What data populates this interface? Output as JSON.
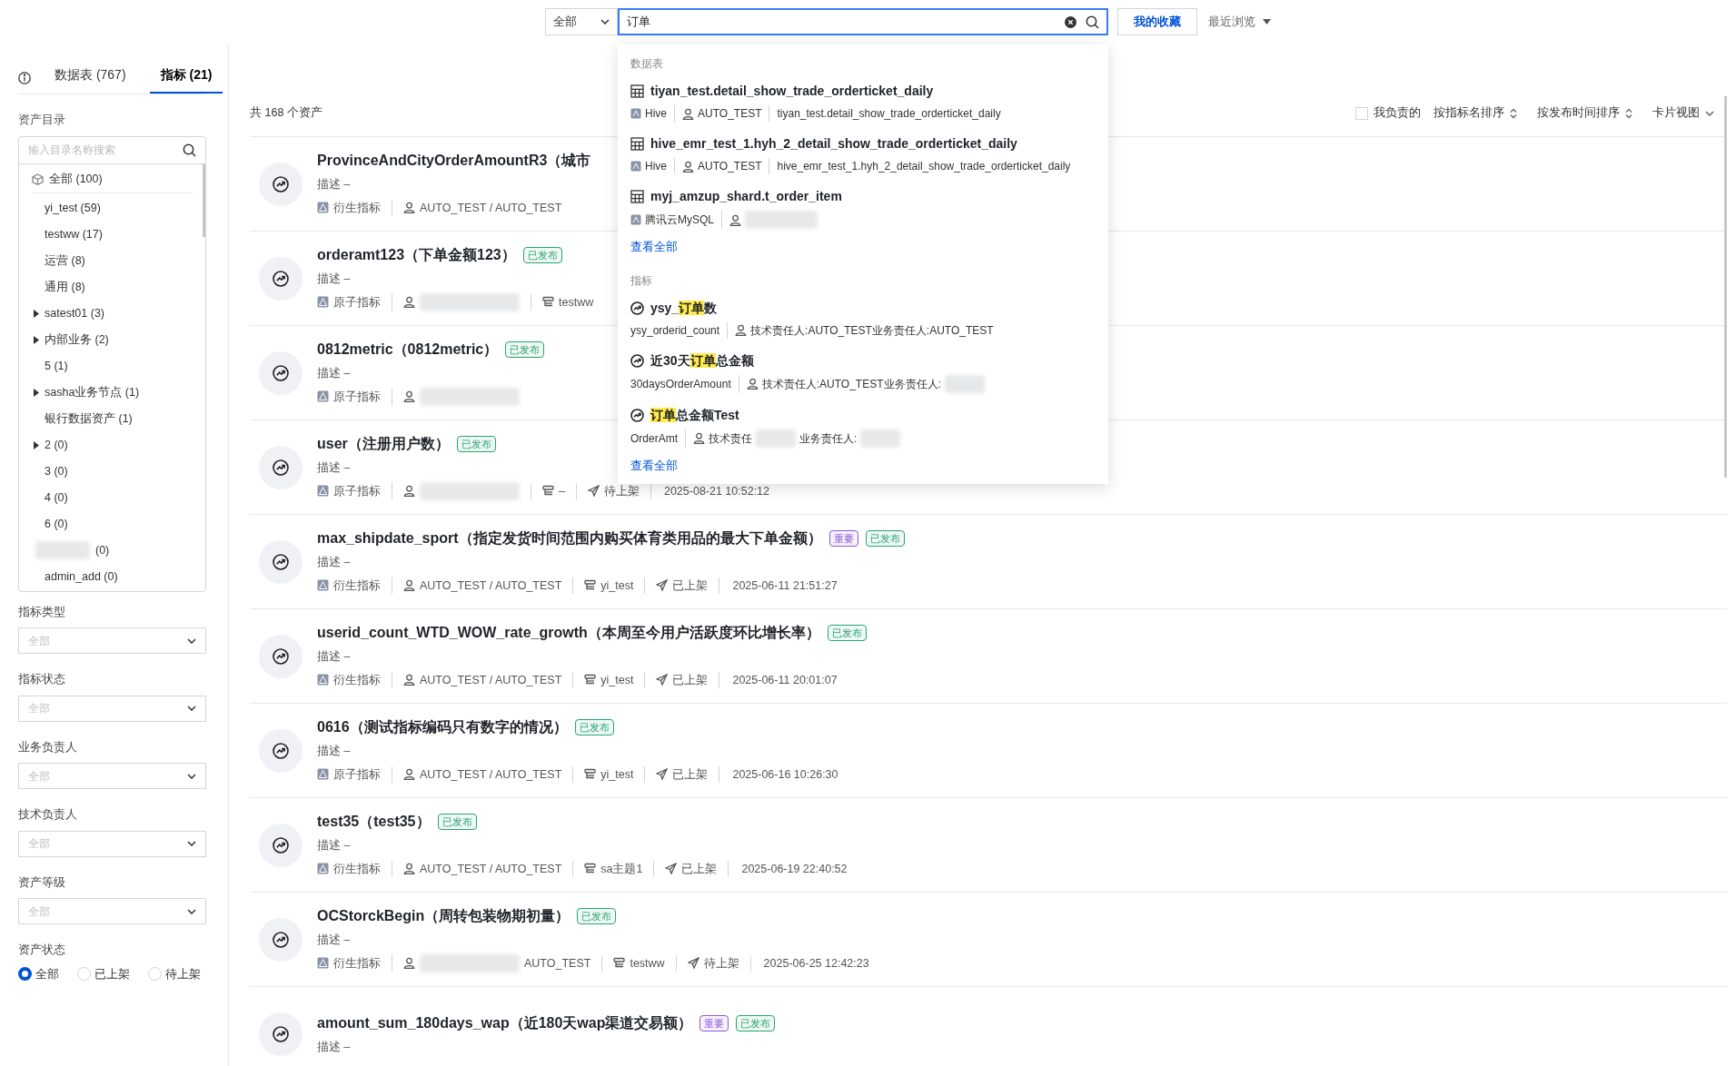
{
  "top_bar": {
    "scope_select": "全部",
    "search": {
      "value": "订单"
    },
    "favorites_button": "我的收藏",
    "recent_menu": "最近浏览"
  },
  "search_dropdown": {
    "sections": [
      {
        "heading": "数据表",
        "view_all": "查看全部",
        "results": [
          {
            "kind": "table",
            "title": "tiyan_test.detail_show_trade_orderticket_daily",
            "source": "Hive",
            "owner": [
              {
                "kind": "text",
                "text": "AUTO_TEST"
              }
            ],
            "path": "tiyan_test.detail_show_trade_orderticket_daily"
          },
          {
            "kind": "table",
            "title": "hive_emr_test_1.hyh_2_detail_show_trade_orderticket_daily",
            "source": "Hive",
            "owner": [
              {
                "kind": "text",
                "text": "AUTO_TEST"
              }
            ],
            "path": "hive_emr_test_1.hyh_2_detail_show_trade_orderticket_daily"
          },
          {
            "kind": "table",
            "title": "myj_amzup_shard.t_order_item",
            "source": "腾讯云MySQL",
            "owner": [
              {
                "kind": "redacted"
              }
            ]
          }
        ]
      },
      {
        "heading": "指标",
        "view_all": "查看全部",
        "results": [
          {
            "kind": "metric",
            "title": [
              {
                "text": "ysy_",
                "highlighted": false
              },
              {
                "text": "订单",
                "highlighted": true
              },
              {
                "text": "数",
                "highlighted": false
              }
            ],
            "code": "ysy_orderid_count",
            "owner": [
              {
                "kind": "text",
                "text": "技术责任人:AUTO_TEST业务责任人:AUTO_TEST"
              }
            ]
          },
          {
            "kind": "metric",
            "title": [
              {
                "text": "近30天",
                "highlighted": false
              },
              {
                "text": "订单",
                "highlighted": true
              },
              {
                "text": "总金额",
                "highlighted": false
              }
            ],
            "code": "30daysOrderAmount",
            "owner": [
              {
                "kind": "text",
                "text": "技术责任人:AUTO_TEST业务责任人:"
              },
              {
                "kind": "redacted"
              }
            ]
          },
          {
            "kind": "metric",
            "title": [
              {
                "text": "订单",
                "highlighted": true
              },
              {
                "text": "总金额Test",
                "highlighted": false
              }
            ],
            "code": "OrderAmt",
            "owner": [
              {
                "kind": "text",
                "text": "技术责任"
              },
              {
                "kind": "redacted"
              },
              {
                "kind": "text",
                "text": "业务责任人:"
              },
              {
                "kind": "redacted"
              }
            ]
          }
        ]
      }
    ]
  },
  "sidebar": {
    "tabs": [
      {
        "label": "数据表 (767)",
        "selected": false
      },
      {
        "label": "指标 (21)",
        "selected": true
      }
    ],
    "catalog": {
      "title": "资产目录",
      "search": {
        "placeholder": "输入目录名称搜索"
      },
      "tree": [
        {
          "kind": "root",
          "label": "全部 (100)",
          "children": [
            {
              "kind": "leaf",
              "label": "yi_test (59)"
            },
            {
              "kind": "leaf",
              "label": "testww (17)"
            },
            {
              "kind": "leaf",
              "label": "运营 (8)"
            },
            {
              "kind": "leaf",
              "label": "通用 (8)"
            },
            {
              "kind": "collapsed",
              "label": "satest01 (3)"
            },
            {
              "kind": "collapsed",
              "label": "内部业务 (2)"
            },
            {
              "kind": "leaf",
              "label": "5 (1)"
            },
            {
              "kind": "collapsed",
              "label": "sasha业务节点 (1)"
            },
            {
              "kind": "leaf",
              "label": "银行数据资产 (1)"
            },
            {
              "kind": "collapsed",
              "label": "2 (0)"
            },
            {
              "kind": "leaf",
              "label": "3 (0)"
            },
            {
              "kind": "leaf",
              "label": "4 (0)"
            },
            {
              "kind": "leaf",
              "label": "6 (0)"
            },
            {
              "kind": "redacted",
              "label": "(0)"
            },
            {
              "kind": "leaf",
              "label": "admin_add (0)"
            }
          ]
        }
      ]
    },
    "filters": [
      {
        "label": "指标类型",
        "placeholder": "全部"
      },
      {
        "label": "指标状态",
        "placeholder": "全部"
      },
      {
        "label": "业务负责人",
        "placeholder": "全部"
      },
      {
        "label": "技术负责人",
        "placeholder": "全部"
      },
      {
        "label": "资产等级",
        "placeholder": "全部"
      }
    ],
    "asset_status": {
      "label": "资产状态",
      "options": [
        {
          "label": "全部",
          "selected": true
        },
        {
          "label": "已上架",
          "selected": false
        },
        {
          "label": "待上架",
          "selected": false
        }
      ]
    }
  },
  "main": {
    "count": "共 168 个资产",
    "mine_checkbox": {
      "label": "我负责的",
      "checked": false
    },
    "sort_options": [
      "按指标名排序",
      "按发布时间排序"
    ],
    "view_select": "卡片视图",
    "rows": [
      {
        "title": "ProvinceAndCityOrderAmountR3（城市",
        "tags": [],
        "description": "描述 –",
        "type": "衍生指标",
        "owner": [
          {
            "kind": "text",
            "text": "AUTO_TEST / AUTO_TEST"
          }
        ]
      },
      {
        "title": "orderamt123（下单金额123）",
        "tags": [
          {
            "label": "已发布",
            "color": "#2ba471"
          }
        ],
        "description": "描述 –",
        "type": "原子指标",
        "owner": [
          {
            "kind": "redacted"
          }
        ],
        "theme": "testww"
      },
      {
        "title": "0812metric（0812metric）",
        "tags": [
          {
            "label": "已发布",
            "color": "#2ba471"
          }
        ],
        "description": "描述 –",
        "type": "原子指标",
        "owner": [
          {
            "kind": "redacted"
          }
        ]
      },
      {
        "title": "user（注册用户数）",
        "tags": [
          {
            "label": "已发布",
            "color": "#2ba471"
          }
        ],
        "description": "描述 –",
        "type": "原子指标",
        "owner": [
          {
            "kind": "redacted"
          }
        ],
        "theme": "–",
        "status": "待上架",
        "published": "2025-08-21 10:52:12"
      },
      {
        "title": "max_shipdate_sport（指定发货时间范围内购买体育类用品的最大下单金额）",
        "tags": [
          {
            "label": "重要",
            "color": "#8e56dd"
          },
          {
            "label": "已发布",
            "color": "#2ba471"
          }
        ],
        "description": "描述 –",
        "type": "衍生指标",
        "owner": [
          {
            "kind": "text",
            "text": "AUTO_TEST / AUTO_TEST"
          }
        ],
        "theme": "yi_test",
        "status": "已上架",
        "published": "2025-06-11 21:51:27"
      },
      {
        "title": "userid_count_WTD_WOW_rate_growth（本周至今用户活跃度环比增长率）",
        "tags": [
          {
            "label": "已发布",
            "color": "#2ba471"
          }
        ],
        "description": "描述 –",
        "type": "衍生指标",
        "owner": [
          {
            "kind": "text",
            "text": "AUTO_TEST / AUTO_TEST"
          }
        ],
        "theme": "yi_test",
        "status": "已上架",
        "published": "2025-06-11 20:01:07"
      },
      {
        "title": "0616（测试指标编码只有数字的情况）",
        "tags": [
          {
            "label": "已发布",
            "color": "#2ba471"
          }
        ],
        "description": "描述 –",
        "type": "原子指标",
        "owner": [
          {
            "kind": "text",
            "text": "AUTO_TEST / AUTO_TEST"
          }
        ],
        "theme": "yi_test",
        "status": "已上架",
        "published": "2025-06-16 10:26:30"
      },
      {
        "title": "test35（test35）",
        "tags": [
          {
            "label": "已发布",
            "color": "#2ba471"
          }
        ],
        "description": "描述 –",
        "type": "衍生指标",
        "owner": [
          {
            "kind": "text",
            "text": "AUTO_TEST / AUTO_TEST"
          }
        ],
        "theme": "sa主题1",
        "status": "已上架",
        "published": "2025-06-19 22:40:52"
      },
      {
        "title": "OCStorckBegin（周转包装物期初量）",
        "tags": [
          {
            "label": "已发布",
            "color": "#2ba471"
          }
        ],
        "description": "描述 –",
        "type": "衍生指标",
        "owner": [
          {
            "kind": "redacted"
          },
          {
            "kind": "text",
            "text": "AUTO_TEST"
          }
        ],
        "theme": "testww",
        "status": "待上架",
        "published": "2025-06-25 12:42:23"
      },
      {
        "title": "amount_sum_180days_wap（近180天wap渠道交易额）",
        "tags": [
          {
            "label": "重要",
            "color": "#8e56dd"
          },
          {
            "label": "已发布",
            "color": "#2ba471"
          }
        ],
        "description": "描述 –"
      }
    ]
  }
}
